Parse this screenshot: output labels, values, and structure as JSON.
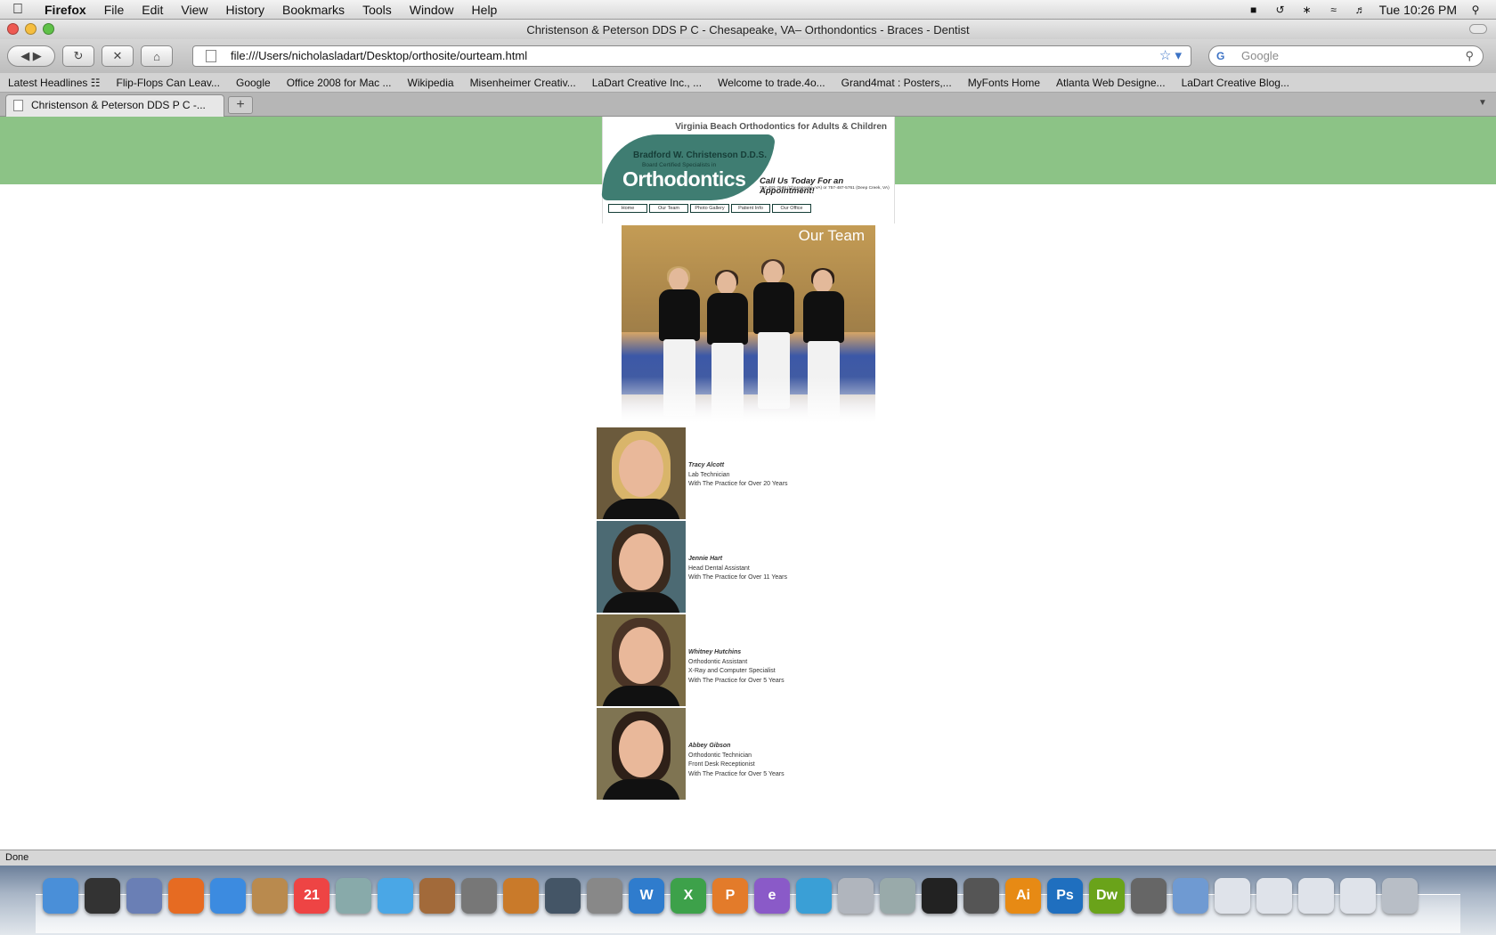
{
  "menubar": {
    "app": "Firefox",
    "items": [
      "File",
      "Edit",
      "View",
      "History",
      "Bookmarks",
      "Tools",
      "Window",
      "Help"
    ],
    "clock": "Tue 10:26 PM"
  },
  "window": {
    "title": "Christenson & Peterson DDS P C - Chesapeake, VA– Orthondontics - Braces - Dentist"
  },
  "toolbar": {
    "url": "file:///Users/nicholasladart/Desktop/orthosite/ourteam.html",
    "search_placeholder": "Google"
  },
  "bookmarks": [
    "Latest Headlines ☷",
    "Flip-Flops Can Leav...",
    "Google",
    "Office 2008 for Mac ...",
    "Wikipedia",
    "Misenheimer Creativ...",
    "LaDart Creative Inc., ...",
    "Welcome to trade.4o...",
    "Grand4mat : Posters,...",
    "MyFonts Home",
    "Atlanta Web Designe...",
    "LaDart Creative Blog..."
  ],
  "tab": {
    "title": "Christenson & Peterson DDS P C -...",
    "new_tab": "+"
  },
  "page": {
    "tagline": "Virginia Beach Orthodontics for Adults & Children",
    "doctor": "Bradford W. Christenson D.D.S.",
    "board": "Board Certified Specialists in",
    "logo_word": "Orthodontics",
    "call": "Call Us Today For an Appointment!",
    "phones": "757-482-7648 (Chesapeake, VA) or 757-487-5761 (Deep Creek, VA)",
    "nav": [
      "Home",
      "Our Team",
      "Photo Gallery",
      "Patient Info",
      "Our Office"
    ],
    "team_heading": "Our Team",
    "members": [
      {
        "name": "Tracy Alcott",
        "lines": [
          "Lab Technician",
          "With The Practice for Over 20 Years"
        ],
        "hair": "#d9b56a"
      },
      {
        "name": "Jennie Hart",
        "lines": [
          "Head Dental Assistant",
          "With The Practice for Over 11 Years"
        ],
        "hair": "#3a2a1e"
      },
      {
        "name": "Whitney Hutchins",
        "lines": [
          "Orthodontic Assistant",
          "X-Ray and Computer Specialist",
          "With The Practice for Over 5 Years"
        ],
        "hair": "#4a3426"
      },
      {
        "name": "Abbey Gibson",
        "lines": [
          "Orthodontic Technician",
          "Front Desk Receptionist",
          "With The Practice for Over 5 Years"
        ],
        "hair": "#2e2018"
      }
    ]
  },
  "status": "Done",
  "dock": [
    {
      "name": "finder",
      "label": "",
      "color": "#4a8fd8"
    },
    {
      "name": "dashboard",
      "label": "",
      "color": "#333"
    },
    {
      "name": "mail-stamp",
      "label": "",
      "color": "#6a7fb5"
    },
    {
      "name": "firefox",
      "label": "",
      "color": "#e66b22"
    },
    {
      "name": "ichat",
      "label": "",
      "color": "#3c8be0"
    },
    {
      "name": "address-book",
      "label": "",
      "color": "#b98a4e"
    },
    {
      "name": "ical",
      "label": "21",
      "color": "#e44"
    },
    {
      "name": "preview",
      "label": "",
      "color": "#8aa"
    },
    {
      "name": "itunes",
      "label": "",
      "color": "#4aa7e6"
    },
    {
      "name": "iphoto",
      "label": "",
      "color": "#a26a3a"
    },
    {
      "name": "imovie",
      "label": "",
      "color": "#777"
    },
    {
      "name": "garageband",
      "label": "",
      "color": "#c97a2a"
    },
    {
      "name": "spaces",
      "label": "",
      "color": "#456"
    },
    {
      "name": "system-preferences",
      "label": "",
      "color": "#888"
    },
    {
      "name": "word",
      "label": "W",
      "color": "#2f7ccd"
    },
    {
      "name": "excel",
      "label": "X",
      "color": "#3da14a"
    },
    {
      "name": "powerpoint",
      "label": "P",
      "color": "#e37b2a"
    },
    {
      "name": "entourage",
      "label": "e",
      "color": "#8a5ac8"
    },
    {
      "name": "messenger",
      "label": "",
      "color": "#3a9fd6"
    },
    {
      "name": "project-gallery",
      "label": "",
      "color": "#b0b5bd"
    },
    {
      "name": "scanner",
      "label": "",
      "color": "#9aa"
    },
    {
      "name": "stuffit",
      "label": "",
      "color": "#222"
    },
    {
      "name": "colorsync",
      "label": "",
      "color": "#555"
    },
    {
      "name": "illustrator",
      "label": "Ai",
      "color": "#e78a14"
    },
    {
      "name": "photoshop",
      "label": "Ps",
      "color": "#1f6fbf"
    },
    {
      "name": "dreamweaver",
      "label": "Dw",
      "color": "#6aa31a"
    },
    {
      "name": "printer",
      "label": "",
      "color": "#666"
    },
    {
      "name": "documents-folder",
      "label": "",
      "color": "#6f9ad2"
    },
    {
      "name": "window-1",
      "label": "",
      "color": "#dfe3ea"
    },
    {
      "name": "window-2",
      "label": "",
      "color": "#dfe3ea"
    },
    {
      "name": "window-3",
      "label": "",
      "color": "#dfe3ea"
    },
    {
      "name": "window-4",
      "label": "",
      "color": "#dfe3ea"
    },
    {
      "name": "trash",
      "label": "",
      "color": "#b8bec6"
    }
  ]
}
